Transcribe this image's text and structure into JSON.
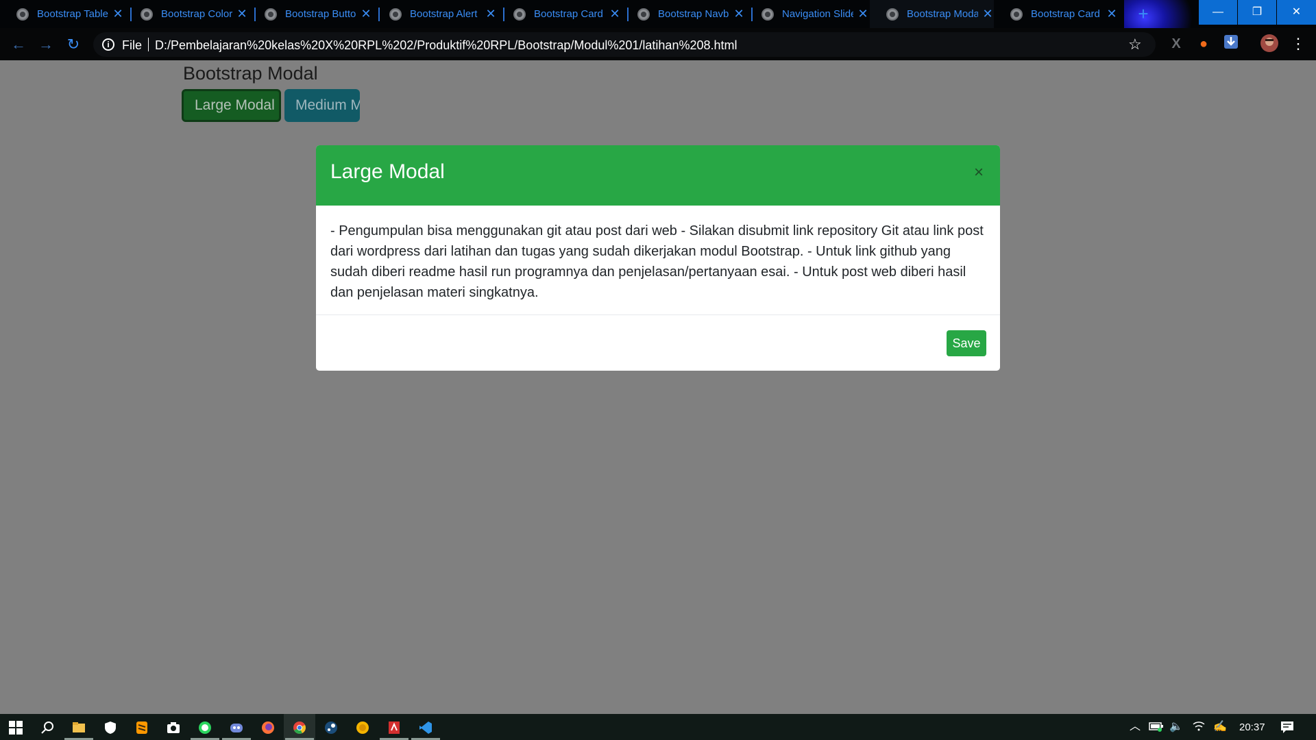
{
  "browser": {
    "tabs": [
      {
        "title": "Bootstrap Table",
        "active": false
      },
      {
        "title": "Bootstrap Color",
        "active": false
      },
      {
        "title": "Bootstrap Button",
        "active": false
      },
      {
        "title": "Bootstrap Alert",
        "active": false
      },
      {
        "title": "Bootstrap Card",
        "active": false
      },
      {
        "title": "Bootstrap Navbar",
        "active": false
      },
      {
        "title": "Navigation Slider",
        "active": false
      },
      {
        "title": "Bootstrap Modal",
        "active": true
      },
      {
        "title": "Bootstrap Card",
        "active": false
      }
    ],
    "new_tab_glyph": "+",
    "window_controls": {
      "minimize": "—",
      "restore": "❐",
      "close": "✕"
    },
    "address": {
      "scheme_label": "File",
      "url": "D:/Pembelajaran%20kelas%20X%20RPL%202/Produktif%20RPL/Bootstrap/Modul%201/latihan%208.html"
    },
    "icons": {
      "back": "back-arrow-icon",
      "forward": "forward-arrow-icon",
      "reload": "reload-icon",
      "info": "info-icon",
      "star": "bookmark-star-icon"
    }
  },
  "page": {
    "title": "Bootstrap Modal",
    "buttons": {
      "large": "Large Modal",
      "medium": "Medium Modal"
    }
  },
  "modal": {
    "title": "Large Modal",
    "close_glyph": "×",
    "body": "- Pengumpulan bisa menggunakan git atau post dari web - Silakan disubmit link repository Git atau link post dari wordpress dari latihan dan tugas yang sudah dikerjakan modul Bootstrap. - Untuk link github yang sudah diberi readme hasil run programnya dan penjelasan/pertanyaan esai. - Untuk post web diberi hasil dan penjelasan materi singkatnya.",
    "save_label": "Save",
    "header_color": "#28a745"
  },
  "taskbar": {
    "apps": [
      "start",
      "search",
      "file-explorer",
      "security",
      "sublime-text",
      "camera",
      "whatsapp",
      "discord",
      "firefox",
      "chrome",
      "steam",
      "norton",
      "acrobat",
      "vscode"
    ],
    "clock": "20:37"
  }
}
